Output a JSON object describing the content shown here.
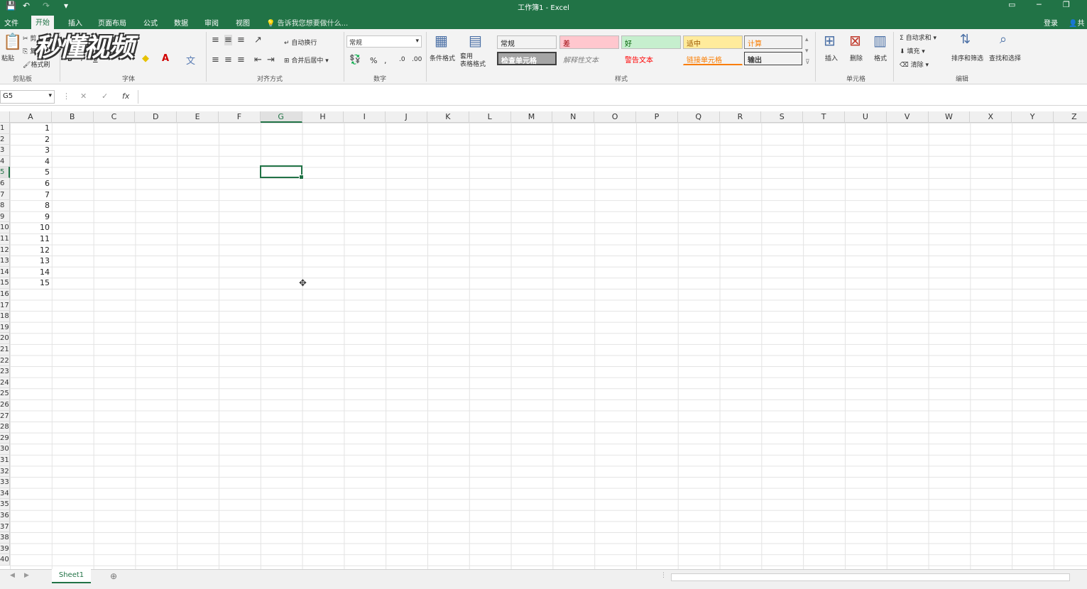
{
  "window": {
    "title": "工作簿1 - Excel",
    "controls": [
      "▭",
      "─",
      "❐"
    ]
  },
  "quick_access": [
    "💾",
    "↶",
    "↷",
    "▾"
  ],
  "tabs": [
    "文件",
    "开始",
    "插入",
    "页面布局",
    "公式",
    "数据",
    "审阅",
    "视图"
  ],
  "active_tab": "开始",
  "tell_me": "告诉我您想要做什么...",
  "account": {
    "login": "登录",
    "share": "共"
  },
  "ribbon": {
    "clipboard": {
      "paste": "粘贴",
      "cut": "剪",
      "copy": "复",
      "format_painter": "格式刷",
      "label": "剪贴板"
    },
    "font": {
      "bold": "B",
      "italic": "I",
      "underline": "U",
      "label": "字体"
    },
    "alignment": {
      "wrap": "自动换行",
      "merge": "合并后居中",
      "label": "对齐方式"
    },
    "number": {
      "format": "常规",
      "percent": "%",
      "comma": ",",
      "inc": ".0",
      "dec": ".00",
      "label": "数字"
    },
    "styles": {
      "conditional": "条件格式",
      "table_format": "套用\n表格格式",
      "cells": [
        {
          "text": "常规",
          "bg": "#ffffff",
          "color": "#222222"
        },
        {
          "text": "差",
          "bg": "#ffc7ce",
          "color": "#9c0006"
        },
        {
          "text": "好",
          "bg": "#c6efce",
          "color": "#006100"
        },
        {
          "text": "适中",
          "bg": "#ffeb9c",
          "color": "#9c5700"
        },
        {
          "text": "计算",
          "bg": "#f2f2f2",
          "color": "#fa7d00"
        },
        {
          "text": "检查单元格",
          "bg": "#a5a5a5",
          "color": "#ffffff"
        },
        {
          "text": "解释性文本",
          "bg": "#ffffff",
          "color": "#7f7f7f"
        },
        {
          "text": "警告文本",
          "bg": "#ffffff",
          "color": "#ff0000"
        },
        {
          "text": "链接单元格",
          "bg": "#ffffff",
          "color": "#fa7d00"
        },
        {
          "text": "输出",
          "bg": "#f2f2f2",
          "color": "#3f3f3f"
        }
      ],
      "label": "样式"
    },
    "cells_group": {
      "insert": "插入",
      "delete": "删除",
      "format": "格式",
      "label": "单元格"
    },
    "editing": {
      "autosum": "自动求和",
      "fill": "填充",
      "clear": "清除",
      "sort": "排序和筛选",
      "find": "查找和选择",
      "label": "编辑"
    }
  },
  "formula_bar": {
    "name_box": "G5",
    "cancel": "✕",
    "enter": "✓",
    "fx": "fx",
    "value": ""
  },
  "columns": [
    "A",
    "B",
    "C",
    "D",
    "E",
    "F",
    "G",
    "H",
    "I",
    "J",
    "K",
    "L",
    "M",
    "N",
    "O",
    "P",
    "Q",
    "R",
    "S",
    "T",
    "U",
    "V",
    "W",
    "X",
    "Y",
    "Z"
  ],
  "selected_column": "G",
  "rows": [
    "1",
    "2",
    "3",
    "4",
    "5",
    "6",
    "7",
    "8",
    "9",
    "10",
    "11",
    "12",
    "13",
    "14",
    "15",
    "16",
    "17",
    "18",
    "19",
    "20",
    "21",
    "22",
    "23",
    "24",
    "25",
    "26",
    "27",
    "28",
    "29",
    "30",
    "31",
    "32",
    "33",
    "34",
    "35",
    "36",
    "37",
    "38",
    "39",
    "40"
  ],
  "selected_row": "5",
  "column_a_values": [
    "1",
    "2",
    "3",
    "4",
    "5",
    "6",
    "7",
    "8",
    "9",
    "10",
    "11",
    "12",
    "13",
    "14",
    "15"
  ],
  "sheets": [
    "Sheet1"
  ],
  "watermark": "秒懂视频",
  "accent": "#217346"
}
